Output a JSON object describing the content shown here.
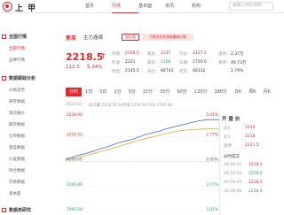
{
  "header": {
    "logo_text": "上 甲",
    "nav": [
      "首页",
      "行情",
      "基本面",
      "资讯",
      "机构"
    ],
    "active_nav": 1,
    "search_placeholder": "请输入代码/简称"
  },
  "sidebar": {
    "groups": [
      {
        "head": "全国行情",
        "items": [
          "全部行情",
          "品种行情"
        ],
        "active_item": 0
      },
      {
        "head": "数据跟踪分析",
        "items": [
          "价格走势",
          "库存数据",
          "现货报价",
          "期货数据",
          "仓单数据",
          "基差数据",
          "价差数据",
          "持仓数据",
          "交易数据",
          "基本面"
        ]
      },
      {
        "head": "数据表研究",
        "items": []
      }
    ]
  },
  "quote": {
    "name": "焦炭",
    "contract": "主力连续",
    "badge_fav": "加自选",
    "badge_info": "下载合约并获取最新行情",
    "price": "2218.5",
    "arrow": "↑",
    "change": "112.5",
    "change_pct": "5.34%",
    "stats": [
      {
        "label": "开盘:",
        "value": "2148.5",
        "color": "red"
      },
      {
        "label": "最高:",
        "value": "2237",
        "color": "red"
      },
      {
        "label": "均价:",
        "value": "2427.5",
        "color": "red"
      },
      {
        "label": "昨收:",
        "value": "2221",
        "color": ""
      },
      {
        "label": "最低:",
        "value": "2106",
        "color": "green"
      },
      {
        "label": "日增:",
        "value": "1750.0",
        "color": ""
      },
      {
        "label": "昨结:",
        "value": "2145.5",
        "color": ""
      },
      {
        "label": "持仓:",
        "value": "84743",
        "color": ""
      },
      {
        "label": "成交:",
        "value": "48132",
        "color": ""
      }
    ],
    "right_stats": [
      {
        "label": "涨停:",
        "value": "2.37万"
      },
      {
        "label": "跌停:",
        "value": "49.73万"
      },
      {
        "label": "",
        "value": "2.79%"
      }
    ]
  },
  "periods": [
    "分时",
    "1日",
    "5日",
    "1分",
    "5分",
    "15分",
    "30分",
    "60分",
    "120分",
    "180分",
    "日K",
    "周K",
    "月K"
  ],
  "active_period": 0,
  "chart_meta": {
    "date_label": "2022-10",
    "info_label": "成交量 2218.50  分时线 2218.50  均价 2195.84"
  },
  "chart_data": {
    "type": "line",
    "left_ticks": [
      "2238.90",
      "2216.55",
      "2196.60",
      "2046.80",
      "1991.60"
    ],
    "right_ticks": [
      "5.41%",
      "2.77%",
      "0.00%",
      "2.77%",
      "5.41%"
    ],
    "series": [
      {
        "values": [
          2120,
          2126,
          2131,
          2135,
          2140,
          2146,
          2150,
          2156,
          2162,
          2166,
          2170,
          2176,
          2182,
          2186,
          2190,
          2196,
          2200,
          2204,
          2208,
          2212,
          2216,
          2218,
          2219,
          2218.5
        ]
      },
      {
        "values": [
          2118,
          2121,
          2125,
          2130,
          2134,
          2139,
          2143,
          2148,
          2153,
          2158,
          2163,
          2168,
          2172,
          2176,
          2180,
          2184,
          2188,
          2191,
          2193,
          2194,
          2195,
          2195.5,
          2195.8,
          2195.84
        ]
      }
    ],
    "ylim": [
      1991.6,
      2238.9
    ]
  },
  "depth": {
    "title": "开 盘 价",
    "rows": [
      {
        "label": "卖5",
        "value": "2219",
        "color": "red"
      },
      {
        "label": "买5",
        "value": "2218",
        "color": "red"
      },
      {
        "label": "涨停",
        "value": "2321.5",
        "color": "red"
      },
      {
        "label": "分时成交",
        "value": "",
        "color": ""
      },
      {
        "label": "14:59:55",
        "value": "2218.5",
        "color": "red"
      },
      {
        "label": "14:59:50",
        "value": "2218.0",
        "color": "green"
      },
      {
        "label": "14:59:45",
        "value": "2218.5",
        "color": "red"
      },
      {
        "label": "14:59:40",
        "value": "2218.0",
        "color": "green"
      }
    ]
  }
}
